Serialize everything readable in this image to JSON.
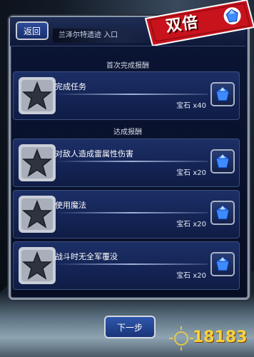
{
  "header": {
    "back_label": "返回",
    "location_title": "兰泽尔特遗迹 入口"
  },
  "badge": {
    "label": "双倍"
  },
  "sections": {
    "first_clear": "首次完成报酬",
    "achievement": "达成报酬"
  },
  "rewards": [
    {
      "title": "完成任务",
      "reward": "宝石 x40"
    },
    {
      "title": "对敌人造成雷属性伤害",
      "reward": "宝石 x20"
    },
    {
      "title": "使用魔法",
      "reward": "宝石 x20"
    },
    {
      "title": "战斗时无全军覆没",
      "reward": "宝石 x20"
    }
  ],
  "footer": {
    "next_label": "下一步"
  },
  "watermark": {
    "text": "18183"
  },
  "colors": {
    "badge_red": "#c8121c",
    "panel_navy": "#0b1535",
    "card_blue": "#1c2f66",
    "gem_blue": "#3d8bff",
    "frame_silver": "#8c97a8"
  },
  "icons": [
    "star-icon",
    "blue-gem-icon",
    "double-badge-gem-icon"
  ]
}
